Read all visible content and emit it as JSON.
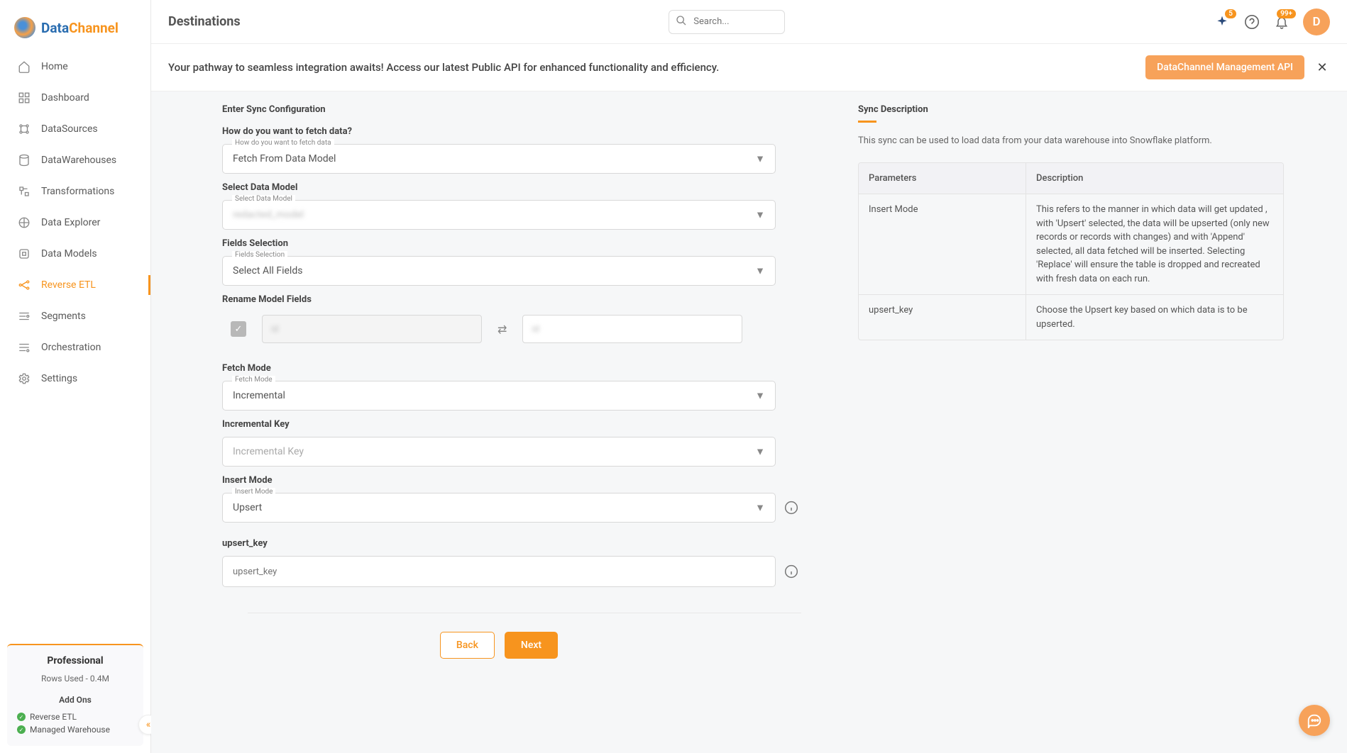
{
  "brand": {
    "part1": "Data",
    "part2": "Channel"
  },
  "nav": {
    "items": [
      {
        "label": "Home"
      },
      {
        "label": "Dashboard"
      },
      {
        "label": "DataSources"
      },
      {
        "label": "DataWarehouses"
      },
      {
        "label": "Transformations"
      },
      {
        "label": "Data Explorer"
      },
      {
        "label": "Data Models"
      },
      {
        "label": "Reverse ETL"
      },
      {
        "label": "Segments"
      },
      {
        "label": "Orchestration"
      },
      {
        "label": "Settings"
      }
    ]
  },
  "plan": {
    "title": "Professional",
    "rows_line": "Rows Used - 0.4M",
    "addons_title": "Add Ons",
    "addons": [
      "Reverse ETL",
      "Managed Warehouse"
    ]
  },
  "header": {
    "page_title": "Destinations",
    "search_placeholder": "Search...",
    "sparkle_badge": "5",
    "bell_badge": "99+",
    "avatar_letter": "D"
  },
  "banner": {
    "text": "Your pathway to seamless integration awaits! Access our latest Public API for enhanced functionality and efficiency.",
    "button": "DataChannel Management API"
  },
  "form": {
    "section_title": "Enter Sync Configuration",
    "fetch_data": {
      "label": "How do you want to fetch data?",
      "float": "How do you want to fetch data",
      "value": "Fetch From Data Model"
    },
    "data_model": {
      "label": "Select Data Model",
      "float": "Select Data Model",
      "value": "redacted_model"
    },
    "fields_selection": {
      "label": "Fields Selection",
      "float": "Fields Selection",
      "value": "Select All Fields"
    },
    "rename": {
      "label": "Rename Model Fields",
      "left": "id",
      "right": "id"
    },
    "fetch_mode": {
      "label": "Fetch Mode",
      "float": "Fetch Mode",
      "value": "Incremental"
    },
    "incremental_key": {
      "label": "Incremental Key",
      "placeholder": "Incremental Key"
    },
    "insert_mode": {
      "label": "Insert Mode",
      "float": "Insert Mode",
      "value": "Upsert"
    },
    "upsert_key": {
      "label": "upsert_key",
      "placeholder": "upsert_key"
    },
    "buttons": {
      "back": "Back",
      "next": "Next"
    }
  },
  "info": {
    "title": "Sync Description",
    "desc": "This sync can be used to load data from your data warehouse into Snowflake platform.",
    "table": {
      "headers": [
        "Parameters",
        "Description"
      ],
      "rows": [
        {
          "param": "Insert Mode",
          "desc": "This refers to the manner in which data will get updated , with 'Upsert' selected, the data will be upserted (only new records or records with changes) and with 'Append' selected, all data fetched will be inserted. Selecting 'Replace' will ensure the table is dropped and recreated with fresh data on each run."
        },
        {
          "param": "upsert_key",
          "desc": "Choose the Upsert key based on which data is to be upserted."
        }
      ]
    }
  }
}
